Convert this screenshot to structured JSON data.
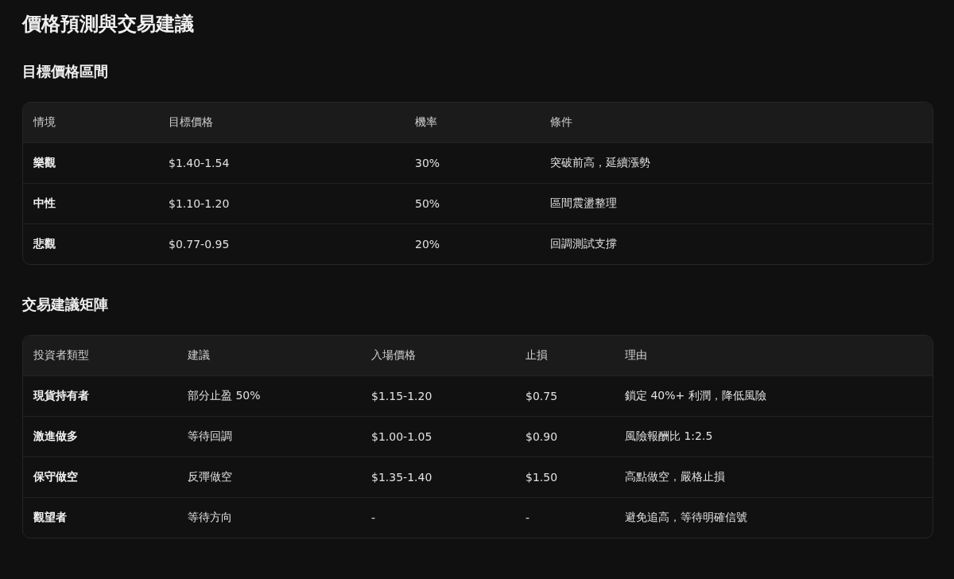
{
  "title": "價格預測與交易建議",
  "sections": [
    {
      "heading": "目標價格區間",
      "table": {
        "columns": [
          "情境",
          "目標價格",
          "機率",
          "條件"
        ],
        "rows": [
          [
            "樂觀",
            "$1.40-1.54",
            "30%",
            "突破前高，延續漲勢"
          ],
          [
            "中性",
            "$1.10-1.20",
            "50%",
            "區間震盪整理"
          ],
          [
            "悲觀",
            "$0.77-0.95",
            "20%",
            "回調測試支撐"
          ]
        ]
      }
    },
    {
      "heading": "交易建議矩陣",
      "table": {
        "columns": [
          "投資者類型",
          "建議",
          "入場價格",
          "止損",
          "理由"
        ],
        "rows": [
          [
            "現貨持有者",
            "部分止盈 50%",
            "$1.15-1.20",
            "$0.75",
            "鎖定 40%+ 利潤，降低風險"
          ],
          [
            "激進做多",
            "等待回調",
            "$1.00-1.05",
            "$0.90",
            "風險報酬比 1:2.5"
          ],
          [
            "保守做空",
            "反彈做空",
            "$1.35-1.40",
            "$1.50",
            "高點做空，嚴格止損"
          ],
          [
            "觀望者",
            "等待方向",
            "-",
            "-",
            "避免追高，等待明確信號"
          ]
        ]
      }
    }
  ]
}
